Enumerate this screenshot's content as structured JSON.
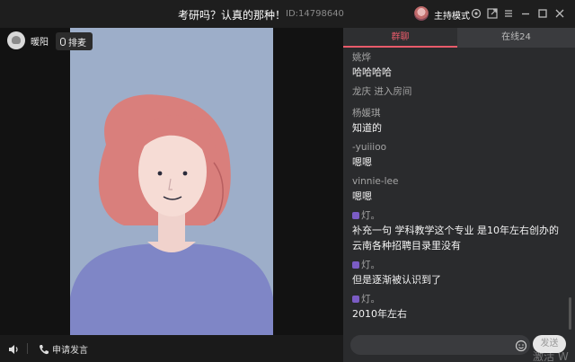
{
  "window": {
    "title": "考研吗？认真的那种！",
    "room_id": "ID:14798640",
    "host_mode": "主持模式",
    "icons": [
      "settings-icon",
      "popout-icon",
      "menu-icon",
      "minimize-icon",
      "maximize-icon",
      "close-icon"
    ]
  },
  "stage": {
    "user_name": "暖阳",
    "queue_label": "排麦",
    "apply_speak": "申请发言"
  },
  "chat": {
    "tabs": [
      {
        "label": "群聊",
        "active": true
      },
      {
        "label": "在线24",
        "active": false
      }
    ],
    "messages": [
      {
        "name": "姚烨",
        "text": "哈哈哈哈"
      },
      {
        "system": "龙庆 进入房间"
      },
      {
        "name": "杨媛琪",
        "text": "知道的"
      },
      {
        "name": "-yuiiioo",
        "text": "嗯嗯"
      },
      {
        "name": "vinnie-lee",
        "text": "嗯嗯"
      },
      {
        "name": "灯。",
        "badge": true,
        "text": "补充一句 学科教学这个专业 是10年左右创办的 云南各种招聘目录里没有"
      },
      {
        "name": "灯。",
        "badge": true,
        "text": "但是逐渐被认识到了"
      },
      {
        "name": "灯。",
        "badge": true,
        "text": "2010年左右"
      }
    ],
    "input_placeholder": "",
    "send_label": "发送"
  },
  "watermark": "激活 W",
  "colors": {
    "accent": "#e85b6a",
    "panel_bg": "#2a2b2d",
    "video_bg": "#9daec9",
    "badge": "#7b5cc4"
  }
}
